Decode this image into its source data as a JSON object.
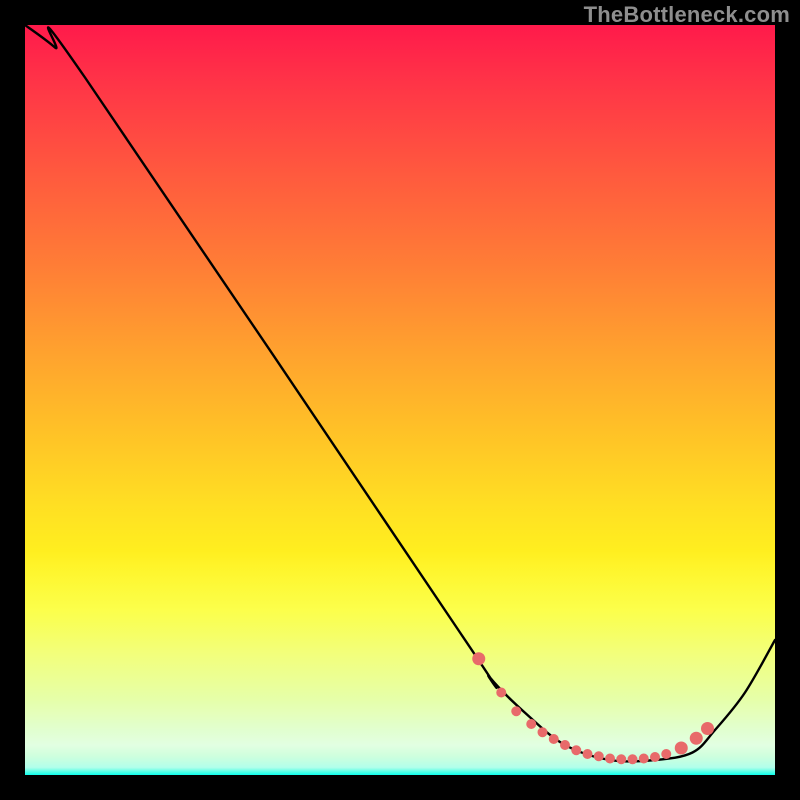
{
  "watermark": "TheBottleneck.com",
  "chart_data": {
    "type": "line",
    "title": "",
    "xlabel": "",
    "ylabel": "",
    "xlim": [
      0,
      100
    ],
    "ylim": [
      0,
      100
    ],
    "series": [
      {
        "name": "bottleneck-curve",
        "x": [
          0,
          4,
          8,
          58,
          62,
          67,
          72,
          78,
          84,
          89,
          92,
          96,
          100
        ],
        "y": [
          100,
          97,
          93,
          19,
          13,
          8,
          4,
          2,
          2,
          3,
          6,
          11,
          18
        ]
      }
    ],
    "markers": {
      "name": "sweet-spot-points",
      "color": "#e86a6a",
      "x": [
        60.5,
        63.5,
        65.5,
        67.5,
        69.0,
        70.5,
        72.0,
        73.5,
        75.0,
        76.5,
        78.0,
        79.5,
        81.0,
        82.5,
        84.0,
        85.5,
        87.5,
        89.5,
        91.0
      ],
      "y": [
        15.5,
        11.0,
        8.5,
        6.8,
        5.7,
        4.8,
        4.0,
        3.3,
        2.8,
        2.5,
        2.2,
        2.1,
        2.1,
        2.2,
        2.4,
        2.8,
        3.6,
        4.9,
        6.2
      ]
    },
    "gradient_stops": [
      {
        "pos": 0.0,
        "color": "#ff1a4b"
      },
      {
        "pos": 0.32,
        "color": "#ff7d36"
      },
      {
        "pos": 0.64,
        "color": "#ffdf23"
      },
      {
        "pos": 0.84,
        "color": "#ebff30"
      },
      {
        "pos": 0.975,
        "color": "#4cff86"
      },
      {
        "pos": 1.0,
        "color": "#0cffee"
      }
    ]
  }
}
